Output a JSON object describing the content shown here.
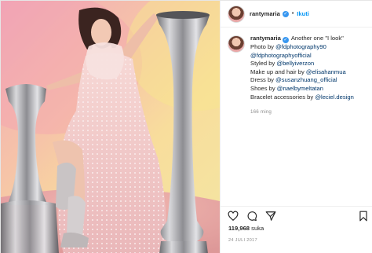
{
  "post": {
    "username": "rantymaria",
    "verified": true,
    "follow_label": "Ikuti",
    "separator": "•",
    "caption": {
      "first_line": "Another one \"I look\"",
      "lines": [
        {
          "prefix": "Photo by ",
          "mention": "@fdphotography90"
        },
        {
          "prefix": "",
          "mention": "@fdphotographyofficial"
        },
        {
          "prefix": "Styled by ",
          "mention": "@bellyiverzon"
        },
        {
          "prefix": "Make up and hair by ",
          "mention": "@elisahanmua"
        },
        {
          "prefix": "Dress by ",
          "mention": "@susanzhuang_official"
        },
        {
          "prefix": "Shoes by ",
          "mention": "@naelbymeltatan"
        },
        {
          "prefix": "Bracelet accessories by ",
          "mention": "@leciel.design"
        }
      ],
      "time_ago": "166 ming"
    },
    "likes_count": "119,968",
    "likes_label": "suka",
    "date": "24 JULI 2017",
    "icons": [
      "heart-icon",
      "comment-icon",
      "share-icon",
      "bookmark-icon"
    ],
    "colors": {
      "accent": "#0095f6",
      "verified": "#3897f0",
      "mention": "#00376b",
      "muted": "#8e8e8e"
    }
  }
}
